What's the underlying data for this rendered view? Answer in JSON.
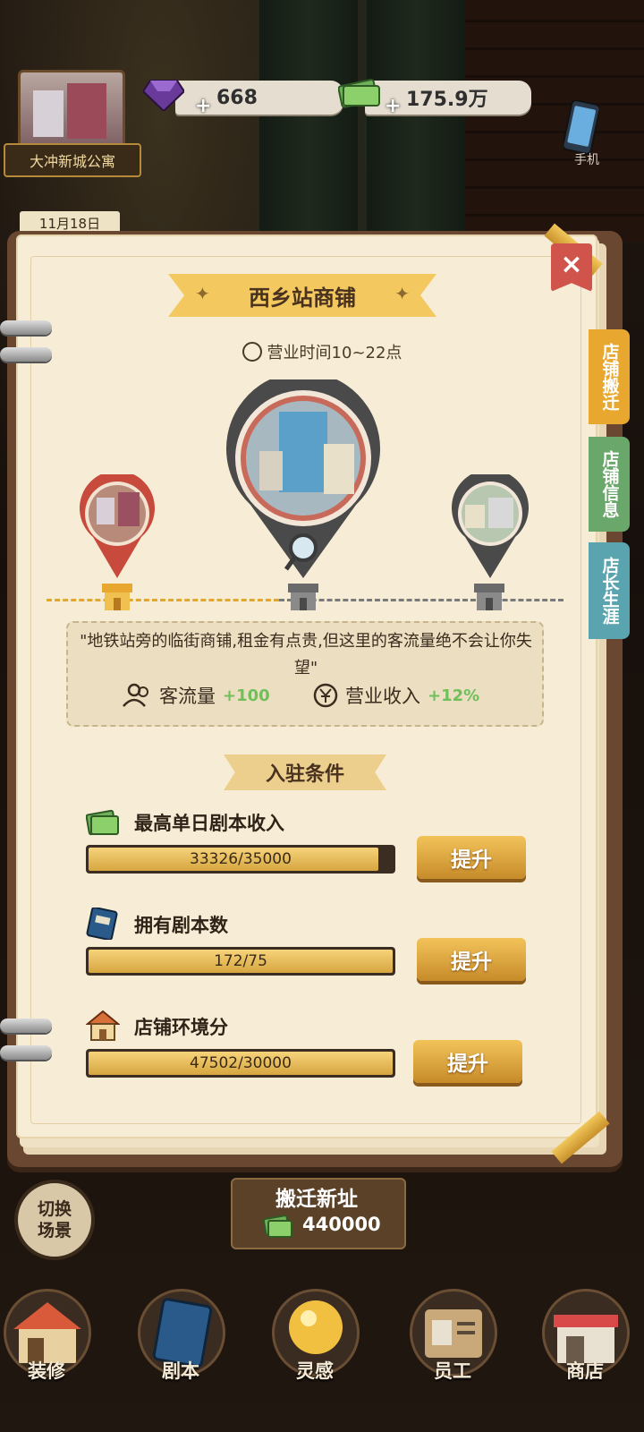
{
  "hud": {
    "scene_name": "大冲新城公寓",
    "date": "11月18日",
    "gems": "668",
    "money": "175.9万",
    "phone_label": "手机"
  },
  "panel": {
    "title": "西乡站商铺",
    "hours": "营业时间10~22点",
    "close_icon": "×",
    "description": "\"地铁站旁的临街商铺,租金有点贵,但这里的客流量绝不会让你失望\"",
    "stats": [
      {
        "label": "客流量",
        "value": "+100",
        "icon": "people-icon"
      },
      {
        "label": "营业收入",
        "value": "+12%",
        "icon": "yuan-icon"
      }
    ],
    "requirements_title": "入驻条件",
    "requirements": [
      {
        "label": "最高单日剧本收入",
        "progress": "33326/35000",
        "fraction": 0.952,
        "button": "提升",
        "icon": "cash-stack-icon"
      },
      {
        "label": "拥有剧本数",
        "progress": "172/75",
        "fraction": 1.0,
        "button": "提升",
        "icon": "script-book-icon"
      },
      {
        "label": "店铺环境分",
        "progress": "47502/30000",
        "fraction": 1.0,
        "button": "提升",
        "icon": "shop-house-icon"
      }
    ]
  },
  "side_tabs": [
    {
      "label": "店铺搬迁",
      "color": "#e8a830"
    },
    {
      "label": "店铺信息",
      "color": "#6aa76a"
    },
    {
      "label": "店长生涯",
      "color": "#5aa4b0"
    }
  ],
  "bottom": {
    "switch_scene": "切换场景",
    "relocate_label": "搬迁新址",
    "relocate_cost": "440000",
    "nav": [
      "装修",
      "剧本",
      "灵感",
      "员工",
      "商店"
    ]
  },
  "colors": {
    "accent": "#f3c85e",
    "stat_value": "#6fbf5a",
    "paper": "#f7edd6"
  }
}
